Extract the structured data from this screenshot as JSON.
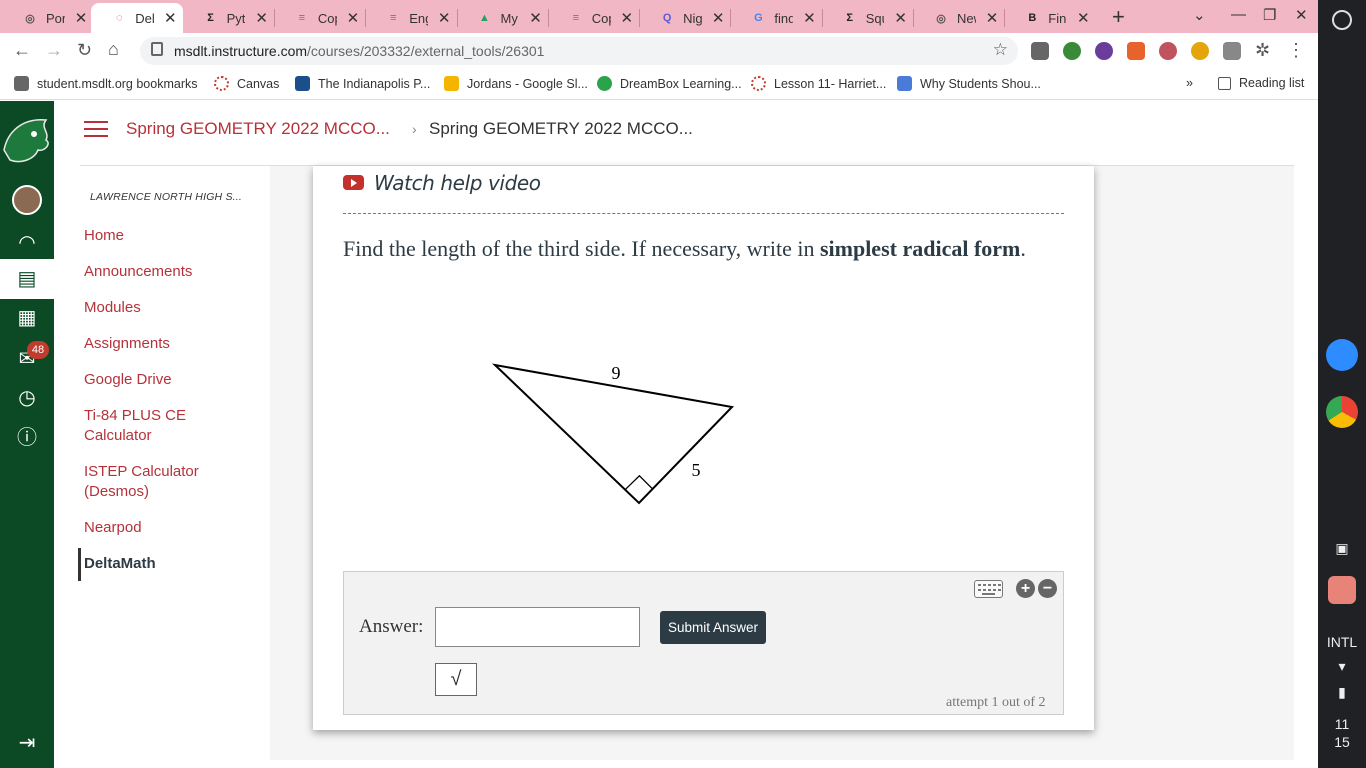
{
  "browser": {
    "tabs": [
      {
        "label": "Porta",
        "active": false,
        "fav_color": "#555555",
        "fav_icon": "chrome-circle-icon"
      },
      {
        "label": "Delta",
        "active": true,
        "fav_color": "#c23c2d",
        "fav_icon": "canvas-icon"
      },
      {
        "label": "Pyth",
        "active": false,
        "fav_color": "#222222",
        "fav_icon": "sigma-icon"
      },
      {
        "label": "Copy",
        "active": false,
        "fav_color": "#4a7bd8",
        "fav_icon": "docs-icon"
      },
      {
        "label": "Eng",
        "active": false,
        "fav_color": "#4a7bd8",
        "fav_icon": "docs-icon"
      },
      {
        "label": "My D",
        "active": false,
        "fav_color": "#1fa463",
        "fav_icon": "drive-icon"
      },
      {
        "label": "Copy",
        "active": false,
        "fav_color": "#4a7bd8",
        "fav_icon": "docs-icon"
      },
      {
        "label": "Nigh",
        "active": false,
        "fav_color": "#5b5bd6",
        "fav_icon": "q-icon"
      },
      {
        "label": "find t",
        "active": false,
        "fav_color": "#4285f4",
        "fav_icon": "google-icon"
      },
      {
        "label": "Squa",
        "active": false,
        "fav_color": "#222222",
        "fav_icon": "sigma-icon"
      },
      {
        "label": "New",
        "active": false,
        "fav_color": "#555555",
        "fav_icon": "chrome-circle-icon"
      },
      {
        "label": "Find",
        "active": false,
        "fav_color": "#222222",
        "fav_icon": "b-icon"
      }
    ],
    "url_host": "msdlt.instructure.com",
    "url_path": "/courses/203332/external_tools/26301",
    "bookmarks": [
      "student.msdlt.org bookmarks",
      "Canvas",
      "The Indianapolis P...",
      "Jordans - Google Sl...",
      "DreamBox Learning...",
      "Lesson 11- Harriet...",
      "Why Students Shou..."
    ],
    "reading_list": "Reading list"
  },
  "shelf": {
    "intl": "INTL",
    "time_hour": "11",
    "time_min": "15"
  },
  "global_nav": {
    "badge_count": "48"
  },
  "header": {
    "crumb1": "Spring GEOMETRY 2022 MCCO...",
    "crumb2": "Spring GEOMETRY 2022 MCCO..."
  },
  "course_nav": {
    "school": "LAWRENCE NORTH HIGH S...",
    "links": [
      "Home",
      "Announcements",
      "Modules",
      "Assignments",
      "Google Drive",
      "Ti-84 PLUS CE Calculator",
      "ISTEP Calculator (Desmos)",
      "Nearpod",
      "DeltaMath"
    ]
  },
  "problem": {
    "help_video": "Watch help video",
    "question_plain": "Find the length of the third side. If necessary, write in ",
    "question_bold": "simplest radical form",
    "question_end": ".",
    "side_hypotenuse": "9",
    "side_leg": "5",
    "answer_label": "Answer:",
    "answer_value": "",
    "submit_label": "Submit Answer",
    "sqrt_label": "√",
    "attempt": "attempt 1 out of 2"
  }
}
